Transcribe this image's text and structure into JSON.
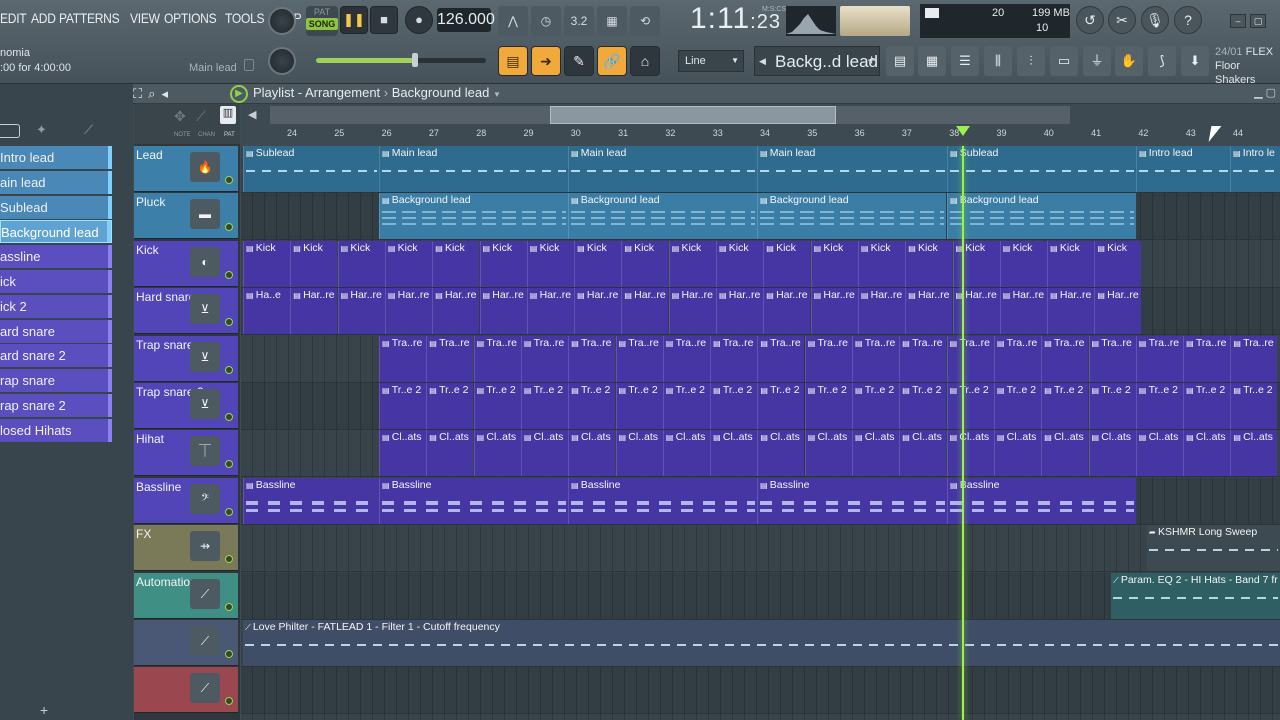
{
  "menu": [
    "EDIT",
    "ADD",
    "PATTERNS",
    "VIEW",
    "OPTIONS",
    "TOOLS",
    "HELP"
  ],
  "hint": {
    "title": "nomia",
    "range": ":00 for 4:00:00",
    "pattern": "Main lead"
  },
  "transport": {
    "pat_label": "PAT",
    "song_label": "SONG",
    "play_icon": "pause-icon",
    "stop_icon": "stop-icon",
    "rec_icon": "record-icon",
    "tempo": "126.000"
  },
  "time": {
    "value": "1:11",
    "sub": ":23",
    "label": "M:S:CS"
  },
  "cpu": {
    "value": "20",
    "memory": "199 MB",
    "polyphony": "10"
  },
  "snap": "Line",
  "pattern_select": "Backg..d lead",
  "news": {
    "date": "24/01",
    "tag": "FLEX",
    "text": "Floor Shakers"
  },
  "playlist": {
    "title": "Playlist - Arrangement",
    "pattern": "Background lead"
  },
  "browser": {
    "patterns": [
      {
        "label": "Intro lead",
        "kind": "blue"
      },
      {
        "label": "ain lead",
        "kind": "blue"
      },
      {
        "label": "Sublead",
        "kind": "blue"
      },
      {
        "label": "Background lead",
        "kind": "selected"
      },
      {
        "label": "assline",
        "kind": "purple"
      },
      {
        "label": "ick",
        "kind": "purple"
      },
      {
        "label": "ick 2",
        "kind": "purple"
      },
      {
        "label": "ard snare",
        "kind": "purple"
      },
      {
        "label": "ard snare 2",
        "kind": "purple"
      },
      {
        "label": "rap snare",
        "kind": "purple"
      },
      {
        "label": "rap snare 2",
        "kind": "purple"
      },
      {
        "label": "losed Hihats",
        "kind": "purple"
      }
    ]
  },
  "track_toolbar": {
    "note": "NOTE",
    "chan": "CHAN",
    "pat": "PAT"
  },
  "tracks": [
    {
      "name": "Lead",
      "icon": "flame-icon",
      "color": "#3c7fa8"
    },
    {
      "name": "Pluck",
      "icon": "piano-icon",
      "color": "#3c7fa8"
    },
    {
      "name": "Kick",
      "icon": "kick-icon",
      "color": "#5145b8"
    },
    {
      "name": "Hard snare",
      "icon": "drum-icon",
      "color": "#5145b8"
    },
    {
      "name": "Trap snare",
      "icon": "drum-icon",
      "color": "#5145b8"
    },
    {
      "name": "Trap snare 2",
      "icon": "drum-icon",
      "color": "#5145b8"
    },
    {
      "name": "Hihat",
      "icon": "hihat-icon",
      "color": "#5145b8"
    },
    {
      "name": "Bassline",
      "icon": "bass-clef-icon",
      "color": "#5145b8"
    },
    {
      "name": "FX",
      "icon": "fx-icon",
      "color": "#7a7a58"
    },
    {
      "name": "Automation",
      "icon": "automation-icon",
      "color": "#3f8f85"
    },
    {
      "name": "",
      "icon": "automation-icon",
      "color": "#4a5876"
    },
    {
      "name": "",
      "icon": "automation-icon",
      "color": "#9a4750"
    }
  ],
  "ruler": [
    "24",
    "25",
    "26",
    "27",
    "28",
    "29",
    "30",
    "31",
    "32",
    "33",
    "34",
    "35",
    "36",
    "37",
    "38",
    "39",
    "40",
    "41",
    "42",
    "43",
    "44"
  ],
  "clips": {
    "lead": [
      "Sublead",
      "Main lead",
      "Main lead",
      "Main lead",
      "Sublead",
      "Intro lead",
      "Intro le"
    ],
    "pluck": [
      "Background lead",
      "Background lead",
      "Background lead",
      "Background lead"
    ],
    "kick": "Kick",
    "hard_snare": "Har..re",
    "trap_snare": "Tra..re",
    "trap_snare2": "Tr..e 2",
    "hihat": "Cl..ats",
    "bassline": [
      "Bassline",
      "Bassline",
      "Bassline",
      "Bassline",
      "Bassline"
    ],
    "fx": "KSHMR Long Sweep",
    "automation": "Param. EQ 2 - HI Hats - Band 7 fr",
    "automation2": "Love Philter - FATLEAD 1 - Filter 1 - Cutoff frequency",
    "hard_snare_first": "Ha..e"
  },
  "colors": {
    "accent_green": "#9bf24a",
    "song_green": "#8fc441",
    "lead_clip": "#2f6b8f",
    "drum_clip": "#4636a3"
  }
}
